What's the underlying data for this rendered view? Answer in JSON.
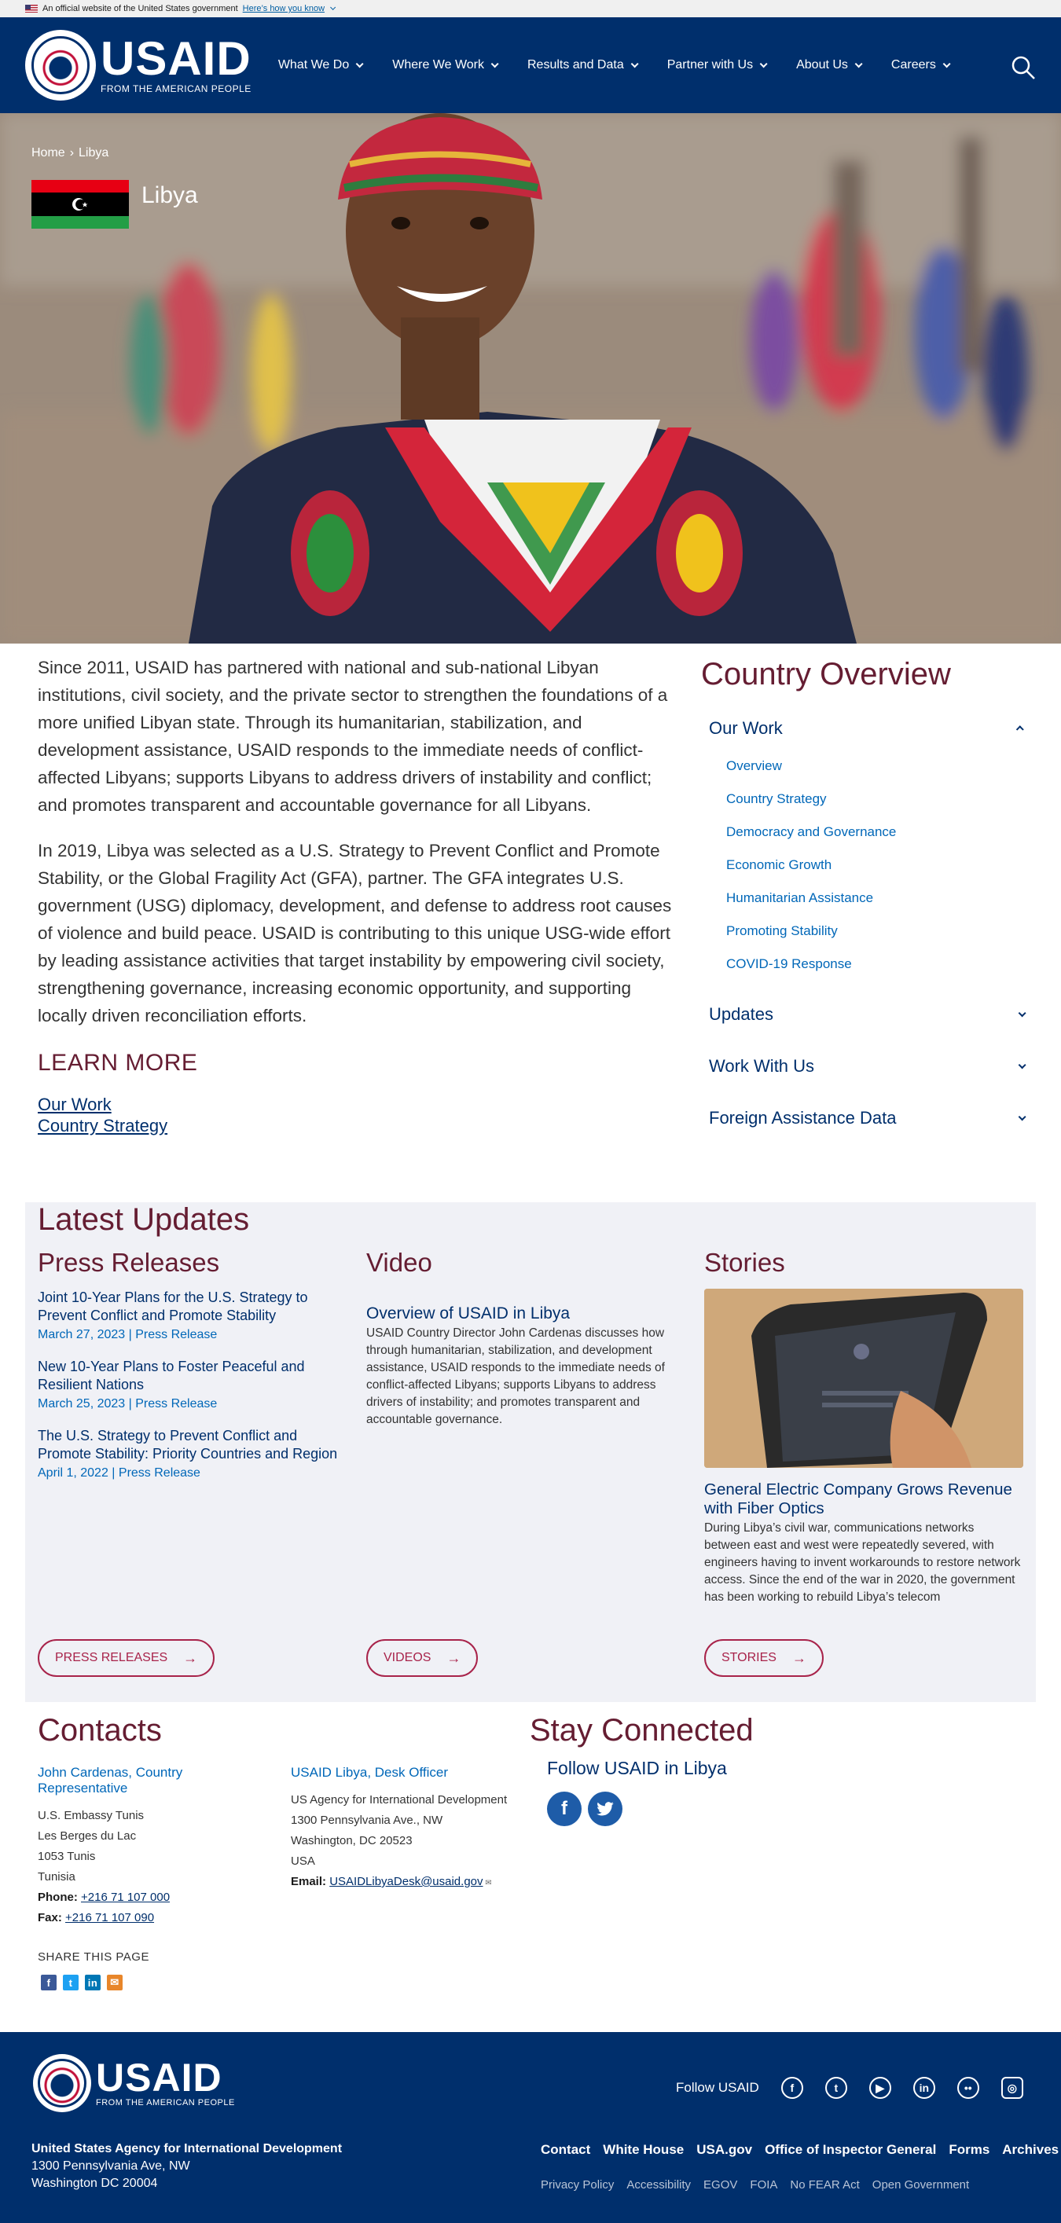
{
  "gov_banner": {
    "text": "An official website of the United States government",
    "link": "Here’s how you know"
  },
  "header": {
    "logo": "USAID",
    "tagline": "FROM THE AMERICAN PEOPLE",
    "nav": [
      "What We Do",
      "Where We Work",
      "Results and Data",
      "Partner with Us",
      "About Us",
      "Careers"
    ],
    "search_icon": "search-icon"
  },
  "hero": {
    "breadcrumb": {
      "home": "Home",
      "sep": "›",
      "current": "Libya"
    },
    "country": "Libya"
  },
  "intro": {
    "p1": "Since 2011, USAID has partnered with national and sub-national Libyan institutions, civil society, and the private sector to strengthen the foundations of a more unified Libyan state. Through its humanitarian, stabilization, and development assistance, USAID responds to the immediate needs of conflict-affected Libyans; supports Libyans to address drivers of instability and conflict; and promotes transparent and accountable governance for all Libyans.",
    "p2": "In 2019, Libya was selected as a U.S. Strategy to Prevent Conflict and Promote Stability, or the Global Fragility Act (GFA), partner. The GFA integrates U.S. government (USG) diplomacy, development, and defense to address root causes of violence and build peace. USAID is contributing to this unique USG-wide effort by leading assistance activities that target instability by empowering civil society, strengthening governance, increasing economic opportunity, and supporting locally driven reconciliation efforts."
  },
  "learn_more": {
    "title": "LEARN MORE",
    "links": [
      "Our Work",
      "Country Strategy"
    ]
  },
  "overview": {
    "title": "Country Overview",
    "sections": [
      {
        "label": "Our Work",
        "open": true,
        "items": [
          "Overview",
          "Country Strategy",
          "Democracy and Governance",
          "Economic Growth",
          "Humanitarian Assistance",
          "Promoting Stability",
          "COVID-19 Response"
        ]
      },
      {
        "label": "Updates",
        "open": false
      },
      {
        "label": "Work With Us",
        "open": false
      },
      {
        "label": "Foreign Assistance Data",
        "open": false
      }
    ]
  },
  "updates": {
    "title": "Latest Updates",
    "press": {
      "title": "Press Releases",
      "items": [
        {
          "title": "Joint 10-Year Plans for the U.S. Strategy to Prevent Conflict and Promote Stability",
          "date": "March 27, 2023",
          "type": "Press Release"
        },
        {
          "title": "New 10-Year Plans to Foster Peaceful and Resilient Nations",
          "date": "March 25, 2023",
          "type": "Press Release"
        },
        {
          "title": "The U.S. Strategy to Prevent Conflict and Promote Stability: Priority Countries and Region",
          "date": "April 1, 2022",
          "type": "Press Release"
        }
      ],
      "button": "PRESS RELEASES"
    },
    "video": {
      "title": "Video",
      "item_title": "Overview of USAID in Libya",
      "item_desc": "USAID Country Director John Cardenas discusses how through humanitarian, stabilization, and development assistance, USAID responds to the immediate needs of conflict-affected Libyans; supports Libyans to address drivers of instability; and promotes transparent and accountable governance.",
      "button": "VIDEOS"
    },
    "stories": {
      "title": "Stories",
      "item_title": "General Electric Company Grows Revenue with Fiber Optics",
      "item_desc": "During Libya’s civil war, communications networks between east and west were repeatedly severed, with engineers having to invent workarounds to restore network access.  Since the end of the war in 2020, the government has been working to rebuild Libya’s telecom",
      "button": "STORIES"
    }
  },
  "contacts": {
    "title": "Contacts",
    "c1": {
      "name": "John Cardenas, Country Representative",
      "lines": [
        "U.S. Embassy Tunis",
        "Les Berges du Lac",
        "1053 Tunis",
        "Tunisia"
      ],
      "phone_label": "Phone:",
      "phone": "+216 71 107 000",
      "fax_label": "Fax:",
      "fax": "+216 71 107 090"
    },
    "c2": {
      "name": "USAID Libya, Desk Officer",
      "lines": [
        "US Agency for International Development",
        "1300 Pennsylvania Ave., NW",
        "Washington, DC 20523",
        "USA"
      ],
      "email_label": "Email:",
      "email": "USAIDLibyaDesk@usaid.gov"
    },
    "share": "SHARE THIS PAGE"
  },
  "stay": {
    "title": "Stay Connected",
    "follow": "Follow USAID in Libya"
  },
  "footer": {
    "logo": "USAID",
    "tagline": "FROM THE AMERICAN PEOPLE",
    "follow": "Follow USAID",
    "org": "United States Agency for International Development",
    "addr1": "1300 Pennsylvania Ave, NW",
    "addr2": "Washington DC 20004",
    "links": [
      "Contact",
      "White House",
      "USA.gov",
      "Office of Inspector General",
      "Forms",
      "Archives"
    ],
    "links2": [
      "Privacy Policy",
      "Accessibility",
      "EGOV",
      "FOIA",
      "No FEAR Act",
      "Open Government"
    ]
  },
  "colors": {
    "navy": "#002f6c",
    "maroon": "#651d32",
    "link": "#0067b8",
    "panel": "#f0f1f6"
  }
}
